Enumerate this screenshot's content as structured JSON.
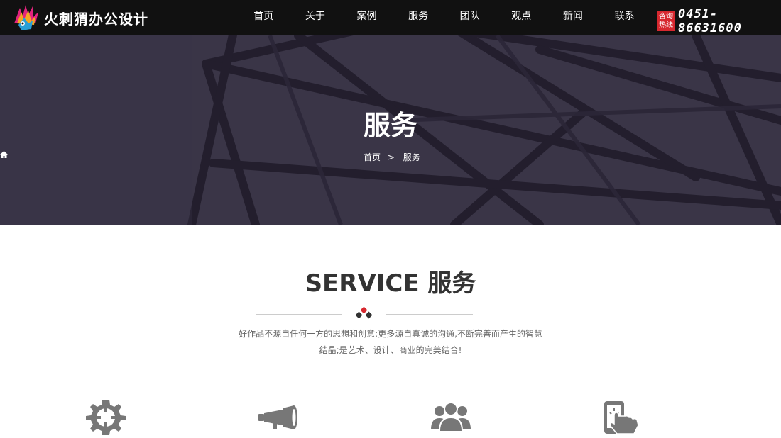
{
  "brand": {
    "name": "火刺猬办公设计",
    "icon": "hedgehog-logo"
  },
  "nav": {
    "items": [
      {
        "label": "首页"
      },
      {
        "label": "关于"
      },
      {
        "label": "案例"
      },
      {
        "label": "服务"
      },
      {
        "label": "团队"
      },
      {
        "label": "观点"
      },
      {
        "label": "新闻"
      },
      {
        "label": "联系"
      }
    ]
  },
  "hotline": {
    "badge_line1": "咨询",
    "badge_line2": "热线",
    "number": "0451- 86631600"
  },
  "banner": {
    "title": "服务",
    "breadcrumb": {
      "home": "首页",
      "separator": ">",
      "current": "服务"
    }
  },
  "section": {
    "title": "SERVICE 服务",
    "description_line1": "好作品不源自任何一方的思想和创意;更多源自真诚的沟通,不断完善而产生的智慧",
    "description_line2": "结晶;是艺术、设计、商业的完美结合!"
  },
  "services": [
    {
      "icon": "gear-icon"
    },
    {
      "icon": "telescope-icon"
    },
    {
      "icon": "team-icon"
    },
    {
      "icon": "mobile-touch-icon"
    }
  ],
  "colors": {
    "topbar": "#111111",
    "banner": "#3a3547",
    "accent": "#d7282f",
    "icon_gray": "#777777"
  }
}
